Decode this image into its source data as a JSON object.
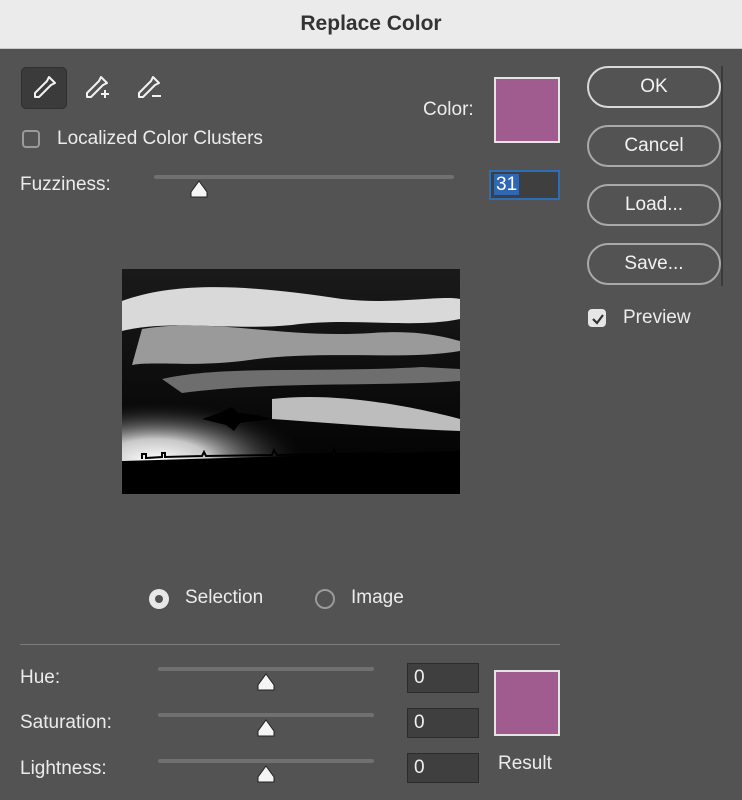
{
  "window": {
    "title": "Replace Color"
  },
  "tools": [
    {
      "icon": "eyedropper-icon",
      "active": true
    },
    {
      "icon": "eyedropper-plus-icon",
      "active": false
    },
    {
      "icon": "eyedropper-minus-icon",
      "active": false
    }
  ],
  "localized_clusters": {
    "label": "Localized Color Clusters",
    "checked": false
  },
  "color": {
    "label": "Color:",
    "value": "#a05c8e"
  },
  "fuzziness": {
    "label": "Fuzziness:",
    "value": "31",
    "fraction": 0.15
  },
  "preview_mode": {
    "options": [
      "Selection",
      "Image"
    ],
    "selected": "Selection"
  },
  "replacement": {
    "hue": {
      "label": "Hue:",
      "value": "0"
    },
    "saturation": {
      "label": "Saturation:",
      "value": "0"
    },
    "lightness": {
      "label": "Lightness:",
      "value": "0"
    },
    "result_label": "Result",
    "result_color": "#a05c8e"
  },
  "buttons": {
    "ok": "OK",
    "cancel": "Cancel",
    "load": "Load...",
    "save": "Save..."
  },
  "preview_toggle": {
    "label": "Preview",
    "checked": true
  }
}
